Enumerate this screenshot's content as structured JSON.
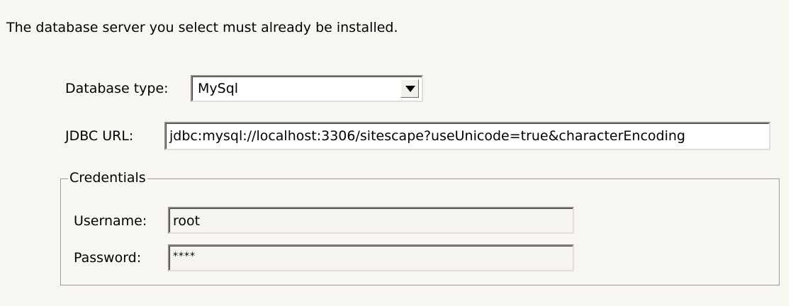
{
  "intro_text": "The database server you select must already be installed.",
  "database_type": {
    "label": "Database type:",
    "selected": "MySql"
  },
  "jdbc_url": {
    "label": "JDBC URL:",
    "value": "jdbc:mysql://localhost:3306/sitescape?useUnicode=true&characterEncoding"
  },
  "credentials": {
    "title": "Credentials",
    "username_label": "Username:",
    "username_value": "root",
    "password_label": "Password:",
    "password_value": "****"
  },
  "icons": {
    "dropdown_arrow": "chevron-down-icon"
  },
  "colors": {
    "panel_background": "#f8f6f0",
    "field_background": "#ffffff",
    "disabled_field_background": "#f6f4ee",
    "border": "#9a968e"
  }
}
